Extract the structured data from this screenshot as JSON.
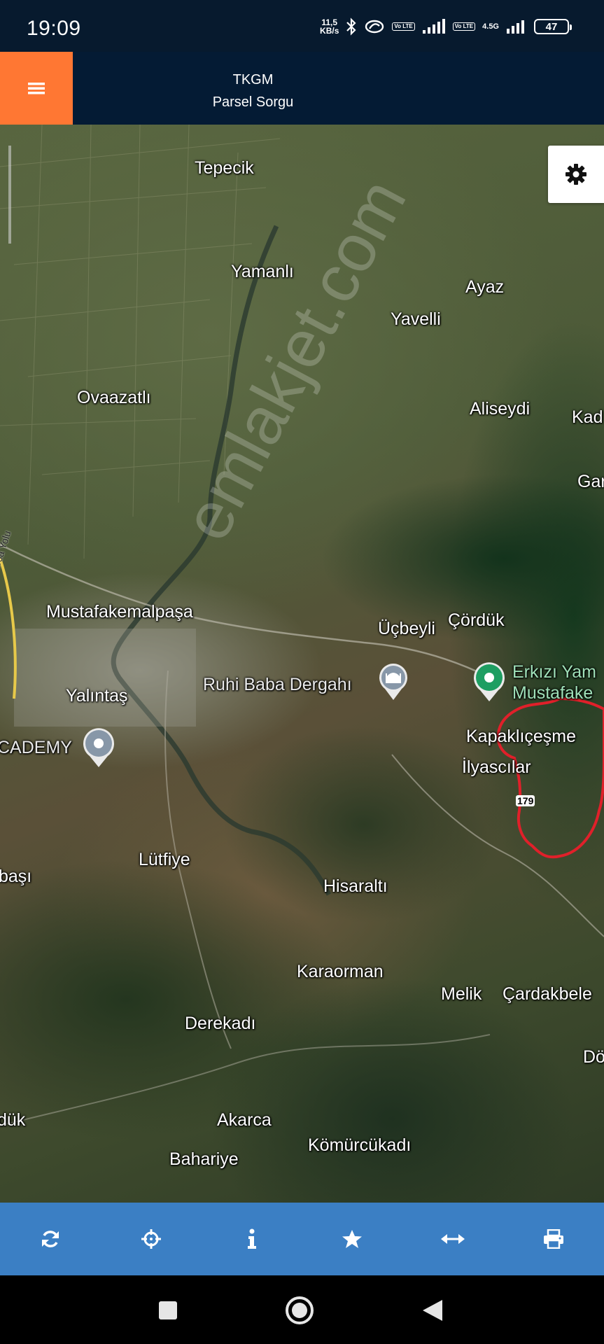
{
  "status_bar": {
    "time": "19:09",
    "net_speed_value": "11,5",
    "net_speed_unit": "KB/s",
    "volte_label": "Vo LTE",
    "network_type": "4.5G",
    "battery": "47"
  },
  "header": {
    "title_line1": "TKGM",
    "title_line2": "Parsel Sorgu"
  },
  "map": {
    "watermark": "emlakjet.com",
    "route_number": "179",
    "places": [
      {
        "name": "Tepecik"
      },
      {
        "name": "Yamanlı"
      },
      {
        "name": "Ayaz"
      },
      {
        "name": "Yavelli"
      },
      {
        "name": "Ovaazatlı"
      },
      {
        "name": "Aliseydi"
      },
      {
        "name": "Kad"
      },
      {
        "name": "Gar"
      },
      {
        "name": "Mustafakemalpaşa"
      },
      {
        "name": "Üçbeyli"
      },
      {
        "name": "Çördük"
      },
      {
        "name": "Yalıntaş"
      },
      {
        "name": "Ruhi Baba Dergahı"
      },
      {
        "name": "Erkızı Yam"
      },
      {
        "name": "Mustafake"
      },
      {
        "name": "Kapaklıçeşme"
      },
      {
        "name": "CADEMY"
      },
      {
        "name": "İlyascılar"
      },
      {
        "name": "Lütfiye"
      },
      {
        "name": "başı"
      },
      {
        "name": "Hisaraltı"
      },
      {
        "name": "Karaorman"
      },
      {
        "name": "Melik"
      },
      {
        "name": "Çardakbele"
      },
      {
        "name": "Derekadı"
      },
      {
        "name": "Dö"
      },
      {
        "name": "dük"
      },
      {
        "name": "Akarca"
      },
      {
        "name": "Kömürcükadı"
      },
      {
        "name": "Bahariye"
      },
      {
        "name": "r Bursa Yolu"
      }
    ]
  },
  "colors": {
    "menu_accent": "#ff7733",
    "header_bg": "#041b34",
    "toolbar_bg": "#3b7fc4",
    "parcel_outline": "#e0202a",
    "poi_pin_green": "#1e9e62"
  },
  "toolbar": {
    "buttons": [
      {
        "icon": "refresh-icon"
      },
      {
        "icon": "crosshairs-icon"
      },
      {
        "icon": "info-icon"
      },
      {
        "icon": "star-icon"
      },
      {
        "icon": "arrows-horizontal-icon"
      },
      {
        "icon": "print-icon"
      }
    ]
  }
}
